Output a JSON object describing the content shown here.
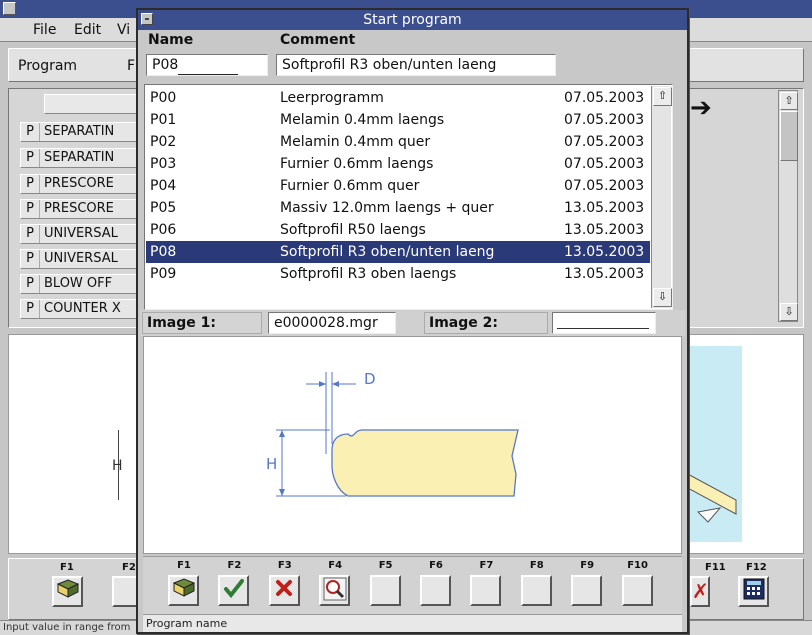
{
  "main_window": {
    "menu": [
      "File",
      "Edit",
      "Vi"
    ],
    "toolbar_label": "Program",
    "toolbar_cut": "F",
    "rows": [
      {
        "p": "P",
        "label": "SEPARATIN"
      },
      {
        "p": "P",
        "label": "SEPARATIN"
      },
      {
        "p": "P",
        "label": "PRESCORE"
      },
      {
        "p": "P",
        "label": "PRESCORE"
      },
      {
        "p": "P",
        "label": "UNIVERSAL"
      },
      {
        "p": "P",
        "label": "UNIVERSAL"
      },
      {
        "p": "P",
        "label": "BLOW OFF"
      },
      {
        "p": "P",
        "label": "COUNTER X"
      }
    ],
    "dim_label": "H",
    "fkeys": [
      "F1",
      "F2",
      "F11",
      "F12"
    ],
    "status": "Input value in range from"
  },
  "dialog": {
    "title": "Start program",
    "col_name": "Name",
    "col_comment": "Comment",
    "name_value": "P08",
    "comment_value": "Softprofil R3 oben/unten laeng",
    "programs": [
      {
        "name": "P00",
        "comment": "Leerprogramm",
        "date": "07.05.2003"
      },
      {
        "name": "P01",
        "comment": "Melamin 0.4mm laengs",
        "date": "07.05.2003"
      },
      {
        "name": "P02",
        "comment": "Melamin 0.4mm quer",
        "date": "07.05.2003"
      },
      {
        "name": "P03",
        "comment": "Furnier 0.6mm laengs",
        "date": "07.05.2003"
      },
      {
        "name": "P04",
        "comment": "Furnier 0.6mm quer",
        "date": "07.05.2003"
      },
      {
        "name": "P05",
        "comment": "Massiv 12.0mm laengs + quer",
        "date": "13.05.2003"
      },
      {
        "name": "P06",
        "comment": "Softprofil R50 laengs",
        "date": "13.05.2003"
      },
      {
        "name": "P08",
        "comment": "Softprofil R3 oben/unten laeng",
        "date": "13.05.2003"
      },
      {
        "name": "P09",
        "comment": "Softprofil R3 oben laengs",
        "date": "13.05.2003"
      }
    ],
    "selected_name": "P08",
    "image1_label": "Image 1:",
    "image1_value": "e0000028.mgr",
    "image2_label": "Image 2:",
    "image2_value": "",
    "drawing": {
      "dim_d": "D",
      "dim_h": "H"
    },
    "fkeys": [
      "F1",
      "F2",
      "F3",
      "F4",
      "F5",
      "F6",
      "F7",
      "F8",
      "F9",
      "F10"
    ],
    "status": "Program name"
  },
  "colors": {
    "titlebar": "#3b4f8f",
    "selection": "#2a3a78",
    "profile_fill": "#fbf0b4",
    "side_panel": "#c9ecf4"
  }
}
